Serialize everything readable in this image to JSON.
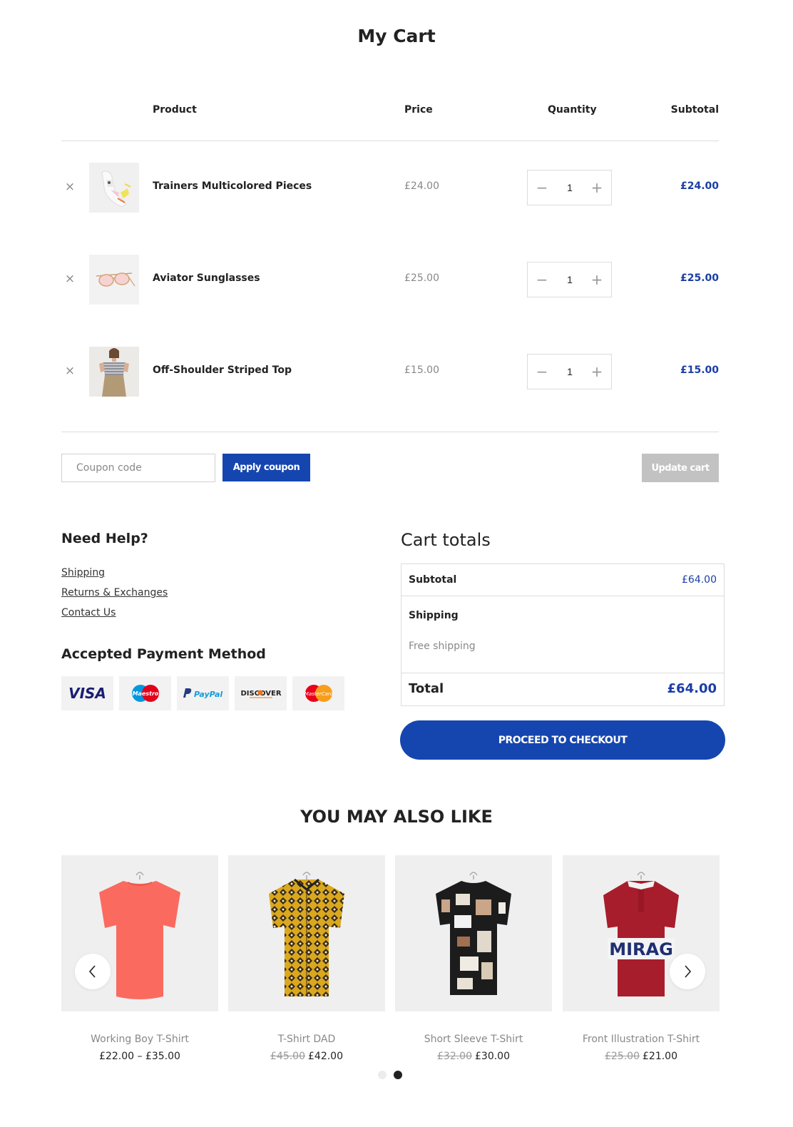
{
  "page": {
    "title": "My Cart"
  },
  "cart": {
    "headers": {
      "product": "Product",
      "price": "Price",
      "quantity": "Quantity",
      "subtotal": "Subtotal"
    },
    "items": [
      {
        "name": "Trainers Multicolored Pieces",
        "price": "£24.00",
        "qty": "1",
        "subtotal": "£24.00",
        "image_icon": "trainers-image"
      },
      {
        "name": "Aviator Sunglasses",
        "price": "£25.00",
        "qty": "1",
        "subtotal": "£25.00",
        "image_icon": "sunglasses-image"
      },
      {
        "name": "Off-Shoulder Striped Top",
        "price": "£15.00",
        "qty": "1",
        "subtotal": "£15.00",
        "image_icon": "striped-top-image"
      }
    ],
    "remove_glyph": "×",
    "minus_glyph": "−",
    "plus_glyph": "+"
  },
  "coupon": {
    "placeholder": "Coupon code",
    "apply_label": "Apply coupon",
    "update_label": "Update cart"
  },
  "help": {
    "title": "Need Help?",
    "links": [
      "Shipping",
      "Returns & Exchanges",
      "Contact Us"
    ],
    "payment_title": "Accepted Payment Method",
    "payment_methods": [
      "VISA",
      "Maestro",
      "PayPal",
      "DISCOVER",
      "MasterCard"
    ]
  },
  "totals": {
    "title": "Cart totals",
    "subtotal_label": "Subtotal",
    "subtotal_value": "£64.00",
    "shipping_label": "Shipping",
    "shipping_value": "Free shipping",
    "total_label": "Total",
    "total_value": "£64.00",
    "checkout_label": "PROCEED TO CHECKOUT"
  },
  "recommendations": {
    "title": "YOU MAY ALSO LIKE",
    "products": [
      {
        "name": "Working Boy T-Shirt",
        "price": "£22.00 – £35.00",
        "old_price": ""
      },
      {
        "name": "T-Shirt DAD",
        "price": "£42.00",
        "old_price": "£45.00"
      },
      {
        "name": "Short Sleeve T-Shirt",
        "price": "£30.00",
        "old_price": "£32.00"
      },
      {
        "name": "Front Illustration T-Shirt",
        "price": "£21.00",
        "old_price": "£25.00"
      }
    ],
    "product_image_text": "MIRAG",
    "carousel": {
      "pages": 2,
      "active_page": 2
    }
  },
  "colors": {
    "accent": "#1546b0",
    "price_blue": "#1b3ea6",
    "disabled": "#c2c2c2"
  }
}
